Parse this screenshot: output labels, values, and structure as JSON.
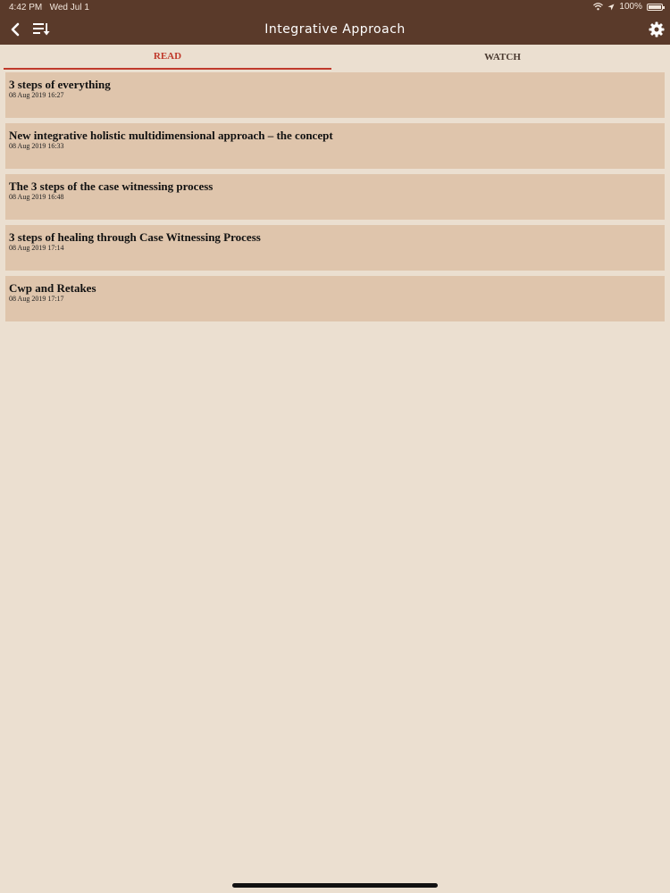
{
  "status_bar": {
    "time": "4:42 PM",
    "date": "Wed Jul 1",
    "battery": "100%"
  },
  "header": {
    "title": "Integrative Approach",
    "back_icon": "chevron-left-icon",
    "sort_icon": "sort-list-icon",
    "settings_icon": "gear-icon",
    "background": "#5a3a2a"
  },
  "tabs": [
    {
      "label": "READ",
      "active": true
    },
    {
      "label": "WATCH",
      "active": false
    }
  ],
  "articles": [
    {
      "title": "3 steps of everything",
      "date": "08 Aug 2019 16:27"
    },
    {
      "title": "New integrative holistic multidimensional approach – the concept",
      "date": "08 Aug 2019 16:33"
    },
    {
      "title": "The 3 steps of the case witnessing process",
      "date": "08 Aug 2019 16:48"
    },
    {
      "title": "3 steps of healing through Case Witnessing Process",
      "date": "08 Aug 2019 17:14"
    },
    {
      "title": "Cwp and Retakes",
      "date": "08 Aug 2019 17:17"
    }
  ],
  "colors": {
    "accent": "#c0392b",
    "item_background": "#dfc5ac",
    "page_background": "#ebdfd0"
  }
}
